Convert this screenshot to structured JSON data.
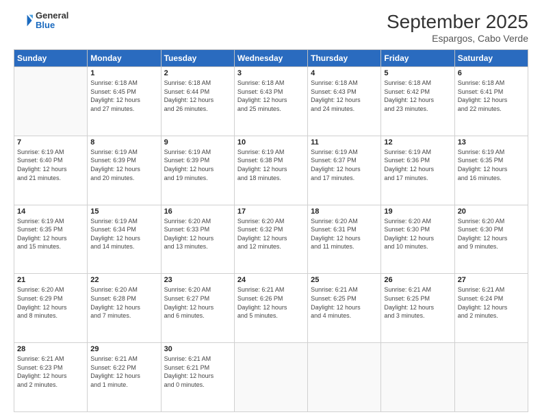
{
  "logo": {
    "general": "General",
    "blue": "Blue"
  },
  "title": {
    "month": "September 2025",
    "location": "Espargos, Cabo Verde"
  },
  "days_of_week": [
    "Sunday",
    "Monday",
    "Tuesday",
    "Wednesday",
    "Thursday",
    "Friday",
    "Saturday"
  ],
  "weeks": [
    [
      {
        "day": "",
        "info": ""
      },
      {
        "day": "1",
        "info": "Sunrise: 6:18 AM\nSunset: 6:45 PM\nDaylight: 12 hours\nand 27 minutes."
      },
      {
        "day": "2",
        "info": "Sunrise: 6:18 AM\nSunset: 6:44 PM\nDaylight: 12 hours\nand 26 minutes."
      },
      {
        "day": "3",
        "info": "Sunrise: 6:18 AM\nSunset: 6:43 PM\nDaylight: 12 hours\nand 25 minutes."
      },
      {
        "day": "4",
        "info": "Sunrise: 6:18 AM\nSunset: 6:43 PM\nDaylight: 12 hours\nand 24 minutes."
      },
      {
        "day": "5",
        "info": "Sunrise: 6:18 AM\nSunset: 6:42 PM\nDaylight: 12 hours\nand 23 minutes."
      },
      {
        "day": "6",
        "info": "Sunrise: 6:18 AM\nSunset: 6:41 PM\nDaylight: 12 hours\nand 22 minutes."
      }
    ],
    [
      {
        "day": "7",
        "info": "Sunrise: 6:19 AM\nSunset: 6:40 PM\nDaylight: 12 hours\nand 21 minutes."
      },
      {
        "day": "8",
        "info": "Sunrise: 6:19 AM\nSunset: 6:39 PM\nDaylight: 12 hours\nand 20 minutes."
      },
      {
        "day": "9",
        "info": "Sunrise: 6:19 AM\nSunset: 6:39 PM\nDaylight: 12 hours\nand 19 minutes."
      },
      {
        "day": "10",
        "info": "Sunrise: 6:19 AM\nSunset: 6:38 PM\nDaylight: 12 hours\nand 18 minutes."
      },
      {
        "day": "11",
        "info": "Sunrise: 6:19 AM\nSunset: 6:37 PM\nDaylight: 12 hours\nand 17 minutes."
      },
      {
        "day": "12",
        "info": "Sunrise: 6:19 AM\nSunset: 6:36 PM\nDaylight: 12 hours\nand 17 minutes."
      },
      {
        "day": "13",
        "info": "Sunrise: 6:19 AM\nSunset: 6:35 PM\nDaylight: 12 hours\nand 16 minutes."
      }
    ],
    [
      {
        "day": "14",
        "info": "Sunrise: 6:19 AM\nSunset: 6:35 PM\nDaylight: 12 hours\nand 15 minutes."
      },
      {
        "day": "15",
        "info": "Sunrise: 6:19 AM\nSunset: 6:34 PM\nDaylight: 12 hours\nand 14 minutes."
      },
      {
        "day": "16",
        "info": "Sunrise: 6:20 AM\nSunset: 6:33 PM\nDaylight: 12 hours\nand 13 minutes."
      },
      {
        "day": "17",
        "info": "Sunrise: 6:20 AM\nSunset: 6:32 PM\nDaylight: 12 hours\nand 12 minutes."
      },
      {
        "day": "18",
        "info": "Sunrise: 6:20 AM\nSunset: 6:31 PM\nDaylight: 12 hours\nand 11 minutes."
      },
      {
        "day": "19",
        "info": "Sunrise: 6:20 AM\nSunset: 6:30 PM\nDaylight: 12 hours\nand 10 minutes."
      },
      {
        "day": "20",
        "info": "Sunrise: 6:20 AM\nSunset: 6:30 PM\nDaylight: 12 hours\nand 9 minutes."
      }
    ],
    [
      {
        "day": "21",
        "info": "Sunrise: 6:20 AM\nSunset: 6:29 PM\nDaylight: 12 hours\nand 8 minutes."
      },
      {
        "day": "22",
        "info": "Sunrise: 6:20 AM\nSunset: 6:28 PM\nDaylight: 12 hours\nand 7 minutes."
      },
      {
        "day": "23",
        "info": "Sunrise: 6:20 AM\nSunset: 6:27 PM\nDaylight: 12 hours\nand 6 minutes."
      },
      {
        "day": "24",
        "info": "Sunrise: 6:21 AM\nSunset: 6:26 PM\nDaylight: 12 hours\nand 5 minutes."
      },
      {
        "day": "25",
        "info": "Sunrise: 6:21 AM\nSunset: 6:25 PM\nDaylight: 12 hours\nand 4 minutes."
      },
      {
        "day": "26",
        "info": "Sunrise: 6:21 AM\nSunset: 6:25 PM\nDaylight: 12 hours\nand 3 minutes."
      },
      {
        "day": "27",
        "info": "Sunrise: 6:21 AM\nSunset: 6:24 PM\nDaylight: 12 hours\nand 2 minutes."
      }
    ],
    [
      {
        "day": "28",
        "info": "Sunrise: 6:21 AM\nSunset: 6:23 PM\nDaylight: 12 hours\nand 2 minutes."
      },
      {
        "day": "29",
        "info": "Sunrise: 6:21 AM\nSunset: 6:22 PM\nDaylight: 12 hours\nand 1 minute."
      },
      {
        "day": "30",
        "info": "Sunrise: 6:21 AM\nSunset: 6:21 PM\nDaylight: 12 hours\nand 0 minutes."
      },
      {
        "day": "",
        "info": ""
      },
      {
        "day": "",
        "info": ""
      },
      {
        "day": "",
        "info": ""
      },
      {
        "day": "",
        "info": ""
      }
    ]
  ]
}
